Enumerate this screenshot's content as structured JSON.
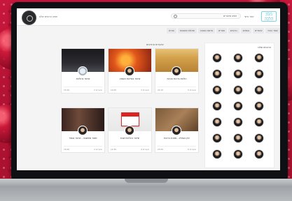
{
  "site": {
    "logo_text": "מכון\nהלכה",
    "search_placeholder": "חפש שיעורים",
    "user_menu": "אזור אישי",
    "top_left_text": "חפש הרבנים שלנו"
  },
  "nav": {
    "items": [
      "עמוד הבית",
      "שיעורים",
      "נושאים",
      "הרבנים",
      "ספרים",
      "פרשת השבוע",
      "שאלות ותשובות",
      "אודות"
    ]
  },
  "sidebar": {
    "title": "הרבנים שלנו"
  },
  "main": {
    "section_title": "שיעורים אחרונים",
    "cards": [
      {
        "title": "שיעור בהלכות",
        "meta_left": "15:20",
        "meta_right": "2 שיעורים"
      },
      {
        "title": "שיעור בפרשת השבוע",
        "meta_left": "14:05",
        "meta_right": "3 שיעורים"
      },
      {
        "title": "הלכות ברכות הנהנין",
        "meta_left": "22:10",
        "meta_right": "5 שיעורים"
      },
      {
        "title": "מוסר ומחשבה - שיעור בספר",
        "meta_left": "18:40",
        "meta_right": "2 שיעורים"
      },
      {
        "title": "שיעור בהלכות שבת",
        "meta_left": "12:30",
        "meta_right": "4 שיעורים"
      },
      {
        "title": "עיון בגמרא - מסכת ברכות",
        "meta_left": "25:00",
        "meta_right": "6 שיעורים"
      }
    ]
  },
  "colors": {
    "accent": "#2bb3c9",
    "background": "#b51434"
  }
}
